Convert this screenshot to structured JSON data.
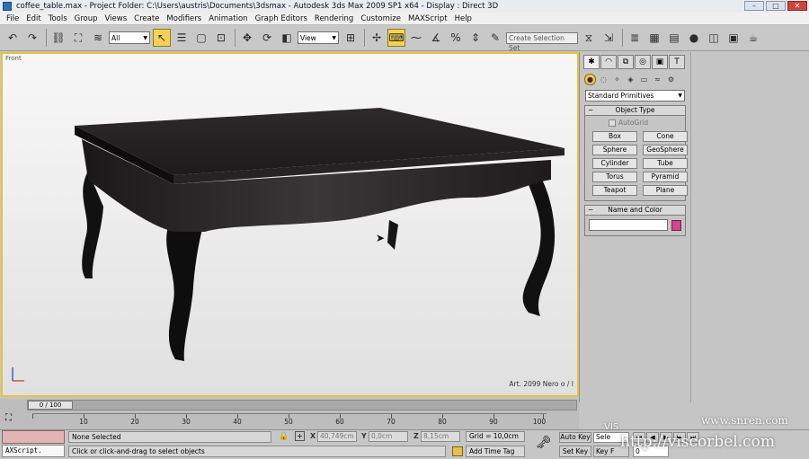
{
  "window": {
    "title": "coffee_table.max     - Project Folder: C:\\Users\\austris\\Documents\\3dsmax     - Autodesk 3ds Max  2009 SP1  x64      - Display : Direct 3D",
    "min": "–",
    "max": "□",
    "close": "✕"
  },
  "menu": [
    "File",
    "Edit",
    "Tools",
    "Group",
    "Views",
    "Create",
    "Modifiers",
    "Animation",
    "Graph Editors",
    "Rendering",
    "Customize",
    "MAXScript",
    "Help"
  ],
  "toolbar": {
    "filter_value": "All",
    "refcoord_value": "View",
    "named_selection_placeholder": "Create Selection Set"
  },
  "viewport": {
    "label": "Front",
    "caption": "Art. 2099 Nero o / I"
  },
  "command_panel": {
    "primitives_dropdown": "Standard Primitives",
    "object_type_title": "Object Type",
    "autogrid_label": "AutoGrid",
    "buttons": [
      "Box",
      "Cone",
      "Sphere",
      "GeoSphere",
      "Cylinder",
      "Tube",
      "Torus",
      "Pyramid",
      "Teapot",
      "Plane"
    ],
    "name_color_title": "Name and Color",
    "object_color": "#d6448c"
  },
  "timeline": {
    "frame_indicator": "0 / 100",
    "ticks": [
      "10",
      "20",
      "30",
      "40",
      "50",
      "60",
      "70",
      "80",
      "90",
      "100"
    ]
  },
  "status": {
    "maxscript_label": "AXScript.",
    "selection": "None Selected",
    "prompt": "Click or click-and-drag to select objects",
    "x_label": "X",
    "x_value": "40,749cm",
    "y_label": "Y",
    "y_value": "0,0cm",
    "z_label": "Z",
    "z_value": "8,15cm",
    "grid": "Grid = 10,0cm",
    "add_time_tag": "Add Time Tag",
    "auto_key": "Auto Key",
    "set_key": "Set Key",
    "selected_dd": "Sele",
    "key_filters": "Key F",
    "frame_value": "0"
  },
  "watermarks": {
    "site1": "www.snren.com",
    "site2": "http://viscorbel.com",
    "vis": "VIS"
  }
}
